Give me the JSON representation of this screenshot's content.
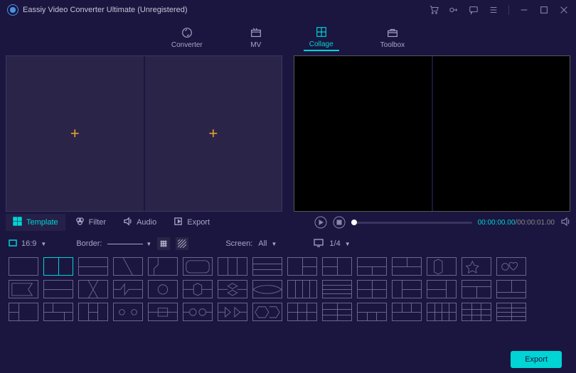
{
  "app": {
    "title": "Eassiy Video Converter Ultimate (Unregistered)"
  },
  "nav": {
    "converter": "Converter",
    "mv": "MV",
    "collage": "Collage",
    "toolbox": "Toolbox"
  },
  "subtabs": {
    "template": "Template",
    "filter": "Filter",
    "audio": "Audio",
    "export": "Export"
  },
  "player": {
    "current_time": "00:00:00.00",
    "total_time": "/00:00:01.00"
  },
  "options": {
    "ratio": "16:9",
    "border_label": "Border:",
    "screen_label": "Screen:",
    "screen_value": "All",
    "display_value": "1/4"
  },
  "footer": {
    "export": "Export"
  }
}
